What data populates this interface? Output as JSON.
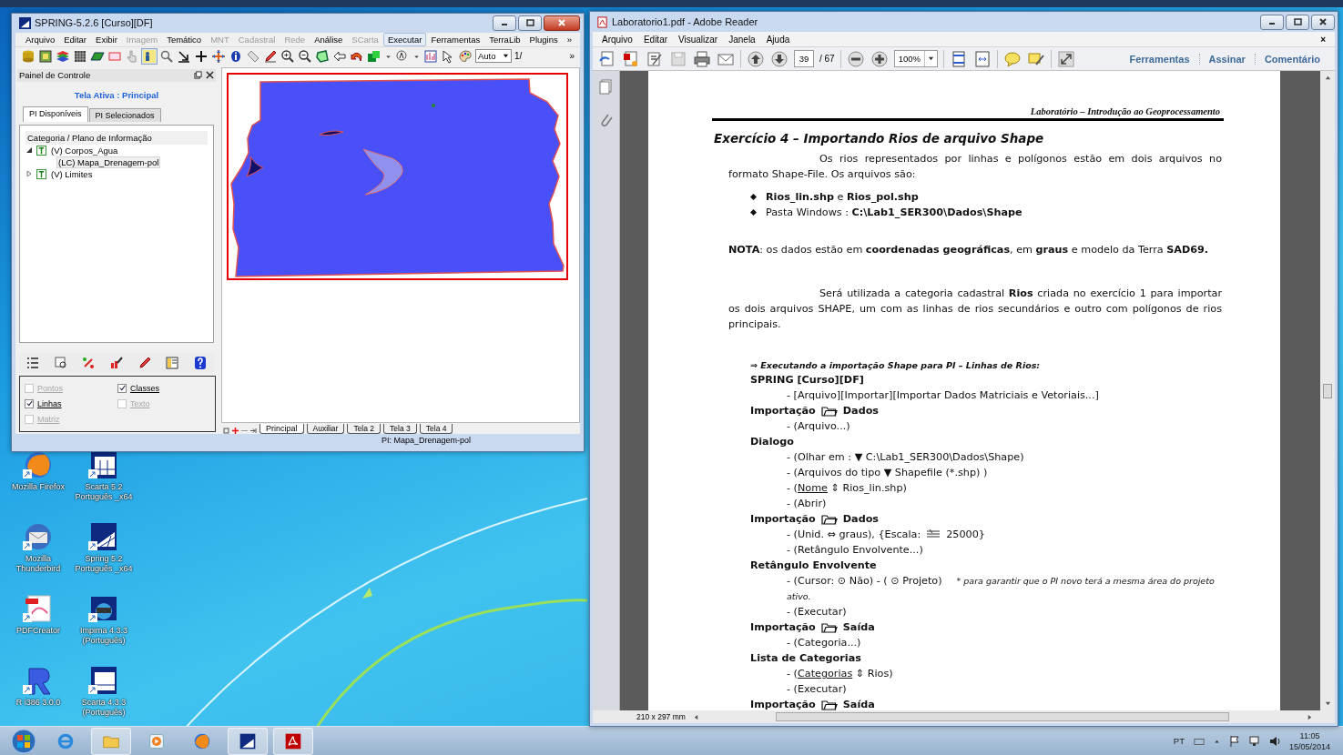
{
  "spring_window": {
    "title": "SPRING-5.2.6 [Curso][DF]",
    "menu": [
      {
        "label": "Arquivo",
        "disabled": false,
        "highlighted": false
      },
      {
        "label": "Editar",
        "disabled": false,
        "highlighted": false
      },
      {
        "label": "Exibir",
        "disabled": false,
        "highlighted": false
      },
      {
        "label": "Imagem",
        "disabled": true,
        "highlighted": false
      },
      {
        "label": "Temático",
        "disabled": false,
        "highlighted": false
      },
      {
        "label": "MNT",
        "disabled": true,
        "highlighted": false
      },
      {
        "label": "Cadastral",
        "disabled": true,
        "highlighted": false
      },
      {
        "label": "Rede",
        "disabled": true,
        "highlighted": false
      },
      {
        "label": "Análise",
        "disabled": false,
        "highlighted": false
      },
      {
        "label": "SCarta",
        "disabled": true,
        "highlighted": false
      },
      {
        "label": "Executar",
        "disabled": false,
        "highlighted": true
      },
      {
        "label": "Ferramentas",
        "disabled": false,
        "highlighted": false
      },
      {
        "label": "TerraLib",
        "disabled": false,
        "highlighted": false
      },
      {
        "label": "Plugins",
        "disabled": false,
        "highlighted": false
      }
    ],
    "menu_overflow": "»",
    "toolbar_overflow": "»",
    "zoom_mode": "Auto",
    "scale_label": "1/",
    "panel": {
      "title": "Painel de Controle",
      "active_screen": "Tela Ativa : Principal",
      "tabs": [
        {
          "label": "PI Disponíveis",
          "selected": true
        },
        {
          "label": "PI Selecionados",
          "selected": false
        }
      ],
      "tree_header": "Categoria / Plano de Informação",
      "tree": [
        {
          "label": "(V) Corpos_Agua",
          "expanded": true,
          "children": [
            {
              "label": "(LC) Mapa_Drenagem-pol",
              "selected": true
            }
          ]
        },
        {
          "label": "(V) Limites",
          "expanded": false
        }
      ],
      "options": [
        {
          "label": "Pontos",
          "checked": false,
          "disabled": true
        },
        {
          "label": "Classes",
          "checked": true,
          "disabled": false
        },
        {
          "label": "Linhas",
          "checked": true,
          "disabled": false
        },
        {
          "label": "Texto",
          "checked": false,
          "disabled": true
        },
        {
          "label": "Matriz",
          "checked": false,
          "disabled": true
        }
      ]
    },
    "screen_tabs": [
      {
        "label": "Principal",
        "selected": true
      },
      {
        "label": "Auxiliar",
        "selected": false
      },
      {
        "label": "Tela 2",
        "selected": false
      },
      {
        "label": "Tela 3",
        "selected": false
      },
      {
        "label": "Tela 4",
        "selected": false
      }
    ],
    "status": "PI: Mapa_Drenagem-pol"
  },
  "reader_window": {
    "title": "Laboratorio1.pdf - Adobe Reader",
    "menu": [
      "Arquivo",
      "Editar",
      "Visualizar",
      "Janela",
      "Ajuda"
    ],
    "menu_close": "×",
    "page_number": "39",
    "page_total": "/ 67",
    "zoom": "100%",
    "links": [
      "Ferramentas",
      "Assinar",
      "Comentário"
    ],
    "page_size": "210 x 297 mm",
    "document": {
      "running_header": "Laboratório – Introdução ao Geoprocessamento",
      "title": "Exercício 4 – Importando Rios de arquivo Shape",
      "blocks": [
        {
          "kind": "paragraph",
          "text": "Os rios representados por linhas e polígonos estão em dois arquivos no formato Shape-File. Os arquivos são:"
        },
        {
          "kind": "bullet",
          "text": "**Rios_lin.shp** e **Rios_pol.shp**"
        },
        {
          "kind": "bullet",
          "text": "Pasta Windows : **C:\\Lab1_SER300\\Dados\\Shape**"
        },
        {
          "kind": "note",
          "text": "**NOTA**: os dados estão em **coordenadas geográficas**, em **graus** e modelo da Terra **SAD69.**"
        },
        {
          "kind": "paragraph",
          "text": "Será utilizada a categoria cadastral **Rios** criada no exercício 1 para importar os dois arquivos SHAPE, um com as linhas de rios secundários e outro com polígonos de rios principais."
        },
        {
          "kind": "subheading",
          "text": "⇒ Executando a importação Shape para PI – Linhas de Rios:"
        },
        {
          "kind": "window",
          "text": "SPRING [Curso][DF]"
        },
        {
          "kind": "step",
          "text": "- [Arquivo][Importar][Importar Dados Matriciais e Vetoriais...]"
        },
        {
          "kind": "dialog",
          "text": "Importação",
          "target": "Dados"
        },
        {
          "kind": "step",
          "text": "- (Arquivo...)"
        },
        {
          "kind": "window",
          "text": "Dialogo"
        },
        {
          "kind": "step",
          "text": "- (Olhar em : ▼ C:\\Lab1_SER300\\Dados\\Shape)"
        },
        {
          "kind": "step",
          "text": "- (Arquivos do tipo ▼ Shapefile (*.shp) )"
        },
        {
          "kind": "field_step",
          "prefix": "- (",
          "field": "Nome",
          "text": "⇕ Rios_lin.shp)"
        },
        {
          "kind": "step",
          "text": "- (Abrir)"
        },
        {
          "kind": "dialog",
          "text": "Importação",
          "target": "Dados"
        },
        {
          "kind": "scale_step",
          "text": "- (Unid. ⇔ graus), {Escala:",
          "value": "25000}"
        },
        {
          "kind": "step",
          "text": "- (Retângulo Envolvente...)"
        },
        {
          "kind": "window",
          "text": "Retângulo Envolvente"
        },
        {
          "kind": "step",
          "text": "- (Cursor: ⊙ Não) - ( ⊙ Projeto)",
          "remark": "* para garantir que o PI novo terá a mesma área do projeto ativo."
        },
        {
          "kind": "step",
          "text": "- (Executar)"
        },
        {
          "kind": "dialog",
          "text": "Importação",
          "target": "Saída"
        },
        {
          "kind": "step",
          "text": "- (Categoria...)"
        },
        {
          "kind": "window",
          "text": "Lista de Categorias"
        },
        {
          "kind": "field_step",
          "prefix": "- (",
          "field": "Categorias",
          "text": "⇕ Rios)"
        },
        {
          "kind": "step",
          "text": "- (Executar)"
        },
        {
          "kind": "dialog",
          "text": "Importação",
          "target": "Saída"
        }
      ]
    }
  },
  "desktop_icons": [
    {
      "label": "Mozilla Firefox"
    },
    {
      "label": "Scarta 5.2 Português _x64"
    },
    {
      "label": "Mozilla Thunderbird"
    },
    {
      "label": "Spring 5.2 Português _x64"
    },
    {
      "label": "PDFCreator"
    },
    {
      "label": "Impima 4.3.3 (Português)"
    },
    {
      "label": "R i386 3.0.0"
    },
    {
      "label": "Scarta 4.3.3 (Português)"
    }
  ],
  "taskbar": {
    "language": "PT",
    "time": "11:05",
    "date": "15/05/2014"
  }
}
